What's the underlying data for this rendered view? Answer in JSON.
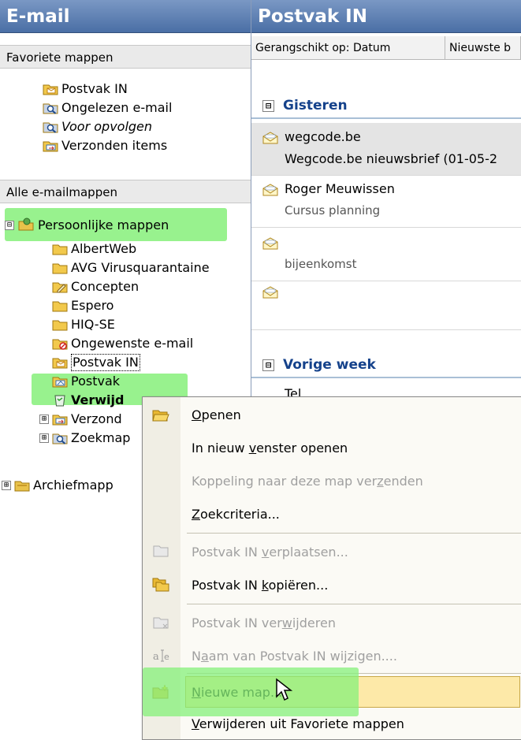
{
  "nav": {
    "title": "E-mail",
    "favorites_header": "Favoriete mappen",
    "favorites": [
      {
        "label": "Postvak IN",
        "icon": "inbox-folder-icon"
      },
      {
        "label": "Ongelezen e-mail",
        "icon": "search-folder-icon"
      },
      {
        "label": "Voor opvolgen",
        "icon": "search-folder-icon",
        "italic": true
      },
      {
        "label": "Verzonden items",
        "icon": "sent-folder-icon"
      }
    ],
    "all_header": "Alle e-mailmappen",
    "root": {
      "label": "Persoonlijke mappen",
      "icon": "personal-folders-icon",
      "expander": "⊟"
    },
    "folders": [
      {
        "label": "AlbertWeb",
        "icon": "folder-icon"
      },
      {
        "label": "AVG Virusquarantaine",
        "icon": "folder-icon"
      },
      {
        "label": "Concepten",
        "icon": "drafts-folder-icon"
      },
      {
        "label": "Espero",
        "icon": "folder-icon"
      },
      {
        "label": "HIQ-SE",
        "icon": "folder-icon"
      },
      {
        "label": "Ongewenste e-mail",
        "icon": "junk-folder-icon"
      },
      {
        "label": "Postvak IN",
        "icon": "inbox-folder-icon",
        "selected": true
      },
      {
        "label": "Postvak",
        "icon": "outbox-folder-icon"
      },
      {
        "label": "Verwijd",
        "icon": "deleted-items-icon",
        "bold": true
      },
      {
        "label": "Verzond",
        "icon": "sent-folder-icon",
        "expander": "⊞"
      },
      {
        "label": "Zoekmap",
        "icon": "search-folder-icon",
        "expander": "⊞"
      }
    ],
    "archive": {
      "label": "Archiefmapp",
      "icon": "archive-folder-icon",
      "expander": "⊞"
    }
  },
  "main": {
    "title": "Postvak IN",
    "sort_label": "Gerangschikt op: Datum",
    "sort_order": "Nieuwste b",
    "groups": [
      {
        "label": "Gisteren",
        "expander": "⊟"
      },
      {
        "label": "Vorige week",
        "expander": "⊟"
      }
    ],
    "messages": [
      {
        "from": "wegcode.be",
        "subject": "Wegcode.be nieuwsbrief (01-05-2",
        "icon": "open-envelope-icon"
      },
      {
        "from": "Roger Meuwissen",
        "subject": "Cursus planning",
        "icon": "open-envelope-icon"
      },
      {
        "from": "",
        "subject": "bijeenkomst",
        "icon": "open-envelope-icon"
      },
      {
        "from": "",
        "subject": "",
        "icon": "open-envelope-icon"
      }
    ],
    "partial_next": "Tel"
  },
  "context_menu": {
    "items": [
      {
        "pre": "",
        "u": "O",
        "post": "penen",
        "disabled": false,
        "icon": "open-folder-icon"
      },
      {
        "pre": "In nieuw ",
        "u": "v",
        "post": "enster openen",
        "disabled": false,
        "icon": ""
      },
      {
        "pre": "Koppeling naar deze map ver",
        "u": "z",
        "post": "enden",
        "disabled": true,
        "icon": ""
      },
      {
        "pre": "",
        "u": "Z",
        "post": "oekcriteria...",
        "disabled": false,
        "icon": ""
      },
      {
        "pre": "Postvak IN ",
        "u": "v",
        "post": "erplaatsen...",
        "disabled": true,
        "icon": "move-folder-icon"
      },
      {
        "pre": "Postvak IN ",
        "u": "k",
        "post": "opiëren...",
        "disabled": false,
        "icon": "copy-folder-icon"
      },
      {
        "pre": "Postvak IN ver",
        "u": "w",
        "post": "ijderen",
        "disabled": true,
        "icon": "delete-folder-icon"
      },
      {
        "pre": "N",
        "u": "a",
        "post": "am van Postvak IN wijzigen....",
        "disabled": true,
        "icon": "rename-icon"
      },
      {
        "pre": "",
        "u": "N",
        "post": "ieuwe map...",
        "disabled": false,
        "icon": "new-folder-icon",
        "hover": true
      },
      {
        "pre": "",
        "u": "V",
        "post": "erwijderen uit Favoriete mappen",
        "disabled": false,
        "icon": ""
      }
    ]
  },
  "colors": {
    "highlight": "#86f07a",
    "header_blue": "#4a6fa5",
    "group_text": "#15428b",
    "hover": "#fde9a8"
  }
}
